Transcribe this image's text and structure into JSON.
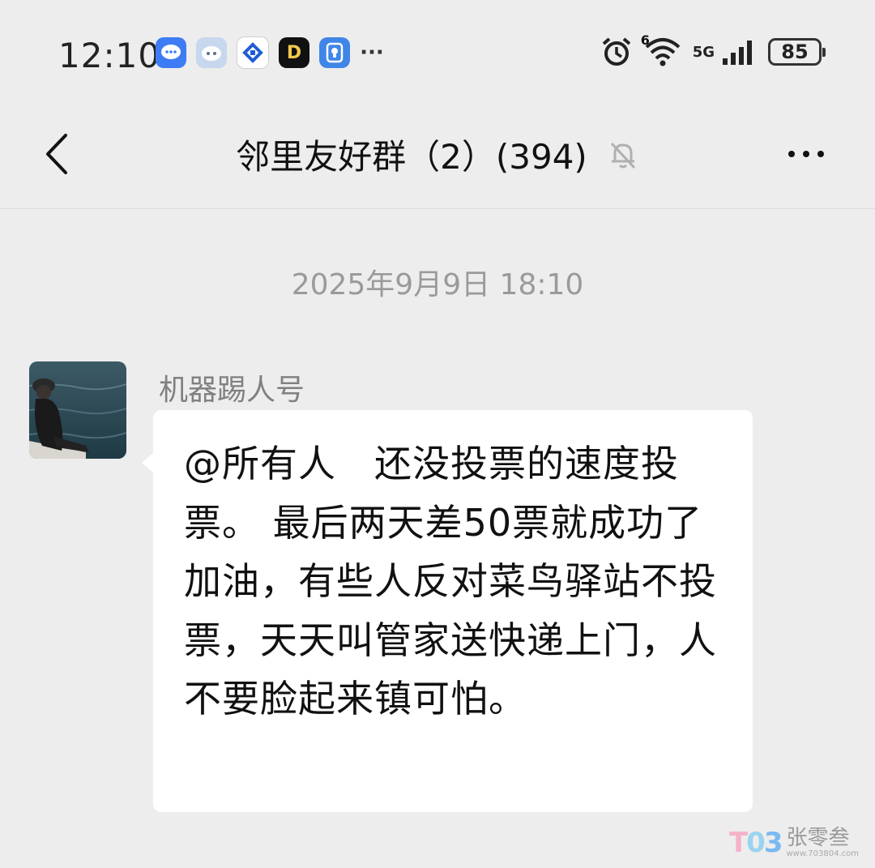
{
  "status_bar": {
    "time": "12:10",
    "more_notifications": "···",
    "network_label": "5G",
    "wifi_badge": "6",
    "battery": "85",
    "notification_icons": [
      "chat-bubble-icon",
      "robot-icon",
      "bank-app-icon",
      "d-app-icon",
      "bulb-app-icon"
    ]
  },
  "nav": {
    "title": "邻里友好群（2）(394)",
    "muted_icon": "bell-muted-icon",
    "back_icon": "chevron-left-icon",
    "more_icon": "more-dots-icon"
  },
  "chat": {
    "timestamp": "2025年9月9日 18:10",
    "messages": [
      {
        "sender": "机器踢人号",
        "text": "@所有人　还没投票的速度投票。 最后两天差50票就成功了加油，有些人反对菜鸟驿站不投票，天天叫管家送快递上门，人不要脸起来镇可怕。"
      }
    ]
  },
  "watermark": {
    "logo": "T03",
    "name": "张零叁",
    "url": "www.703804.com"
  },
  "colors": {
    "background": "#ededed",
    "bubble": "#ffffff",
    "timestamp": "#9a9a9a",
    "sender": "#808080"
  }
}
